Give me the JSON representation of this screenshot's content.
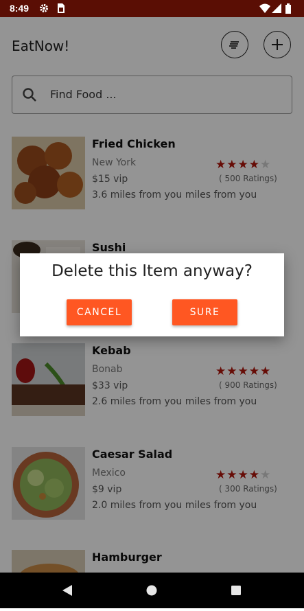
{
  "status_bar": {
    "time": "8:49",
    "icons": [
      "gear-icon",
      "sim-card-icon",
      "wifi-icon",
      "signal-icon",
      "battery-icon"
    ]
  },
  "header": {
    "title": "EatNow!",
    "filter_icon": "sort-lines-icon",
    "add_icon": "plus-icon"
  },
  "search": {
    "placeholder": "Find Food ...",
    "icon": "search-icon"
  },
  "foods": [
    {
      "name": "Fried Chicken",
      "location": "New York",
      "price": "$15 vip",
      "distance": "3.6 miles from you miles from you",
      "rating": 4,
      "ratings_text": "( 500 Ratings)"
    },
    {
      "name": "Sushi"
    },
    {
      "name": "Kebab",
      "location": "Bonab",
      "price": "$33 vip",
      "distance": "2.6 miles from you miles from you",
      "rating": 5,
      "ratings_text": "( 900 Ratings)"
    },
    {
      "name": "Caesar Salad",
      "location": "Mexico",
      "price": "$9 vip",
      "distance": "2.0 miles from you miles from you",
      "rating": 4,
      "ratings_text": "( 300 Ratings)"
    },
    {
      "name": "Hamburger"
    }
  ],
  "dialog": {
    "message": "Delete this Item anyway?",
    "cancel_label": "CANCEL",
    "confirm_label": "SURE"
  },
  "colors": {
    "status_bar": "#5a0e04",
    "accent": "#ff5722",
    "star": "#b0160c"
  },
  "nav_bar": {
    "icons": [
      "back-icon",
      "home-icon",
      "recents-icon"
    ]
  }
}
